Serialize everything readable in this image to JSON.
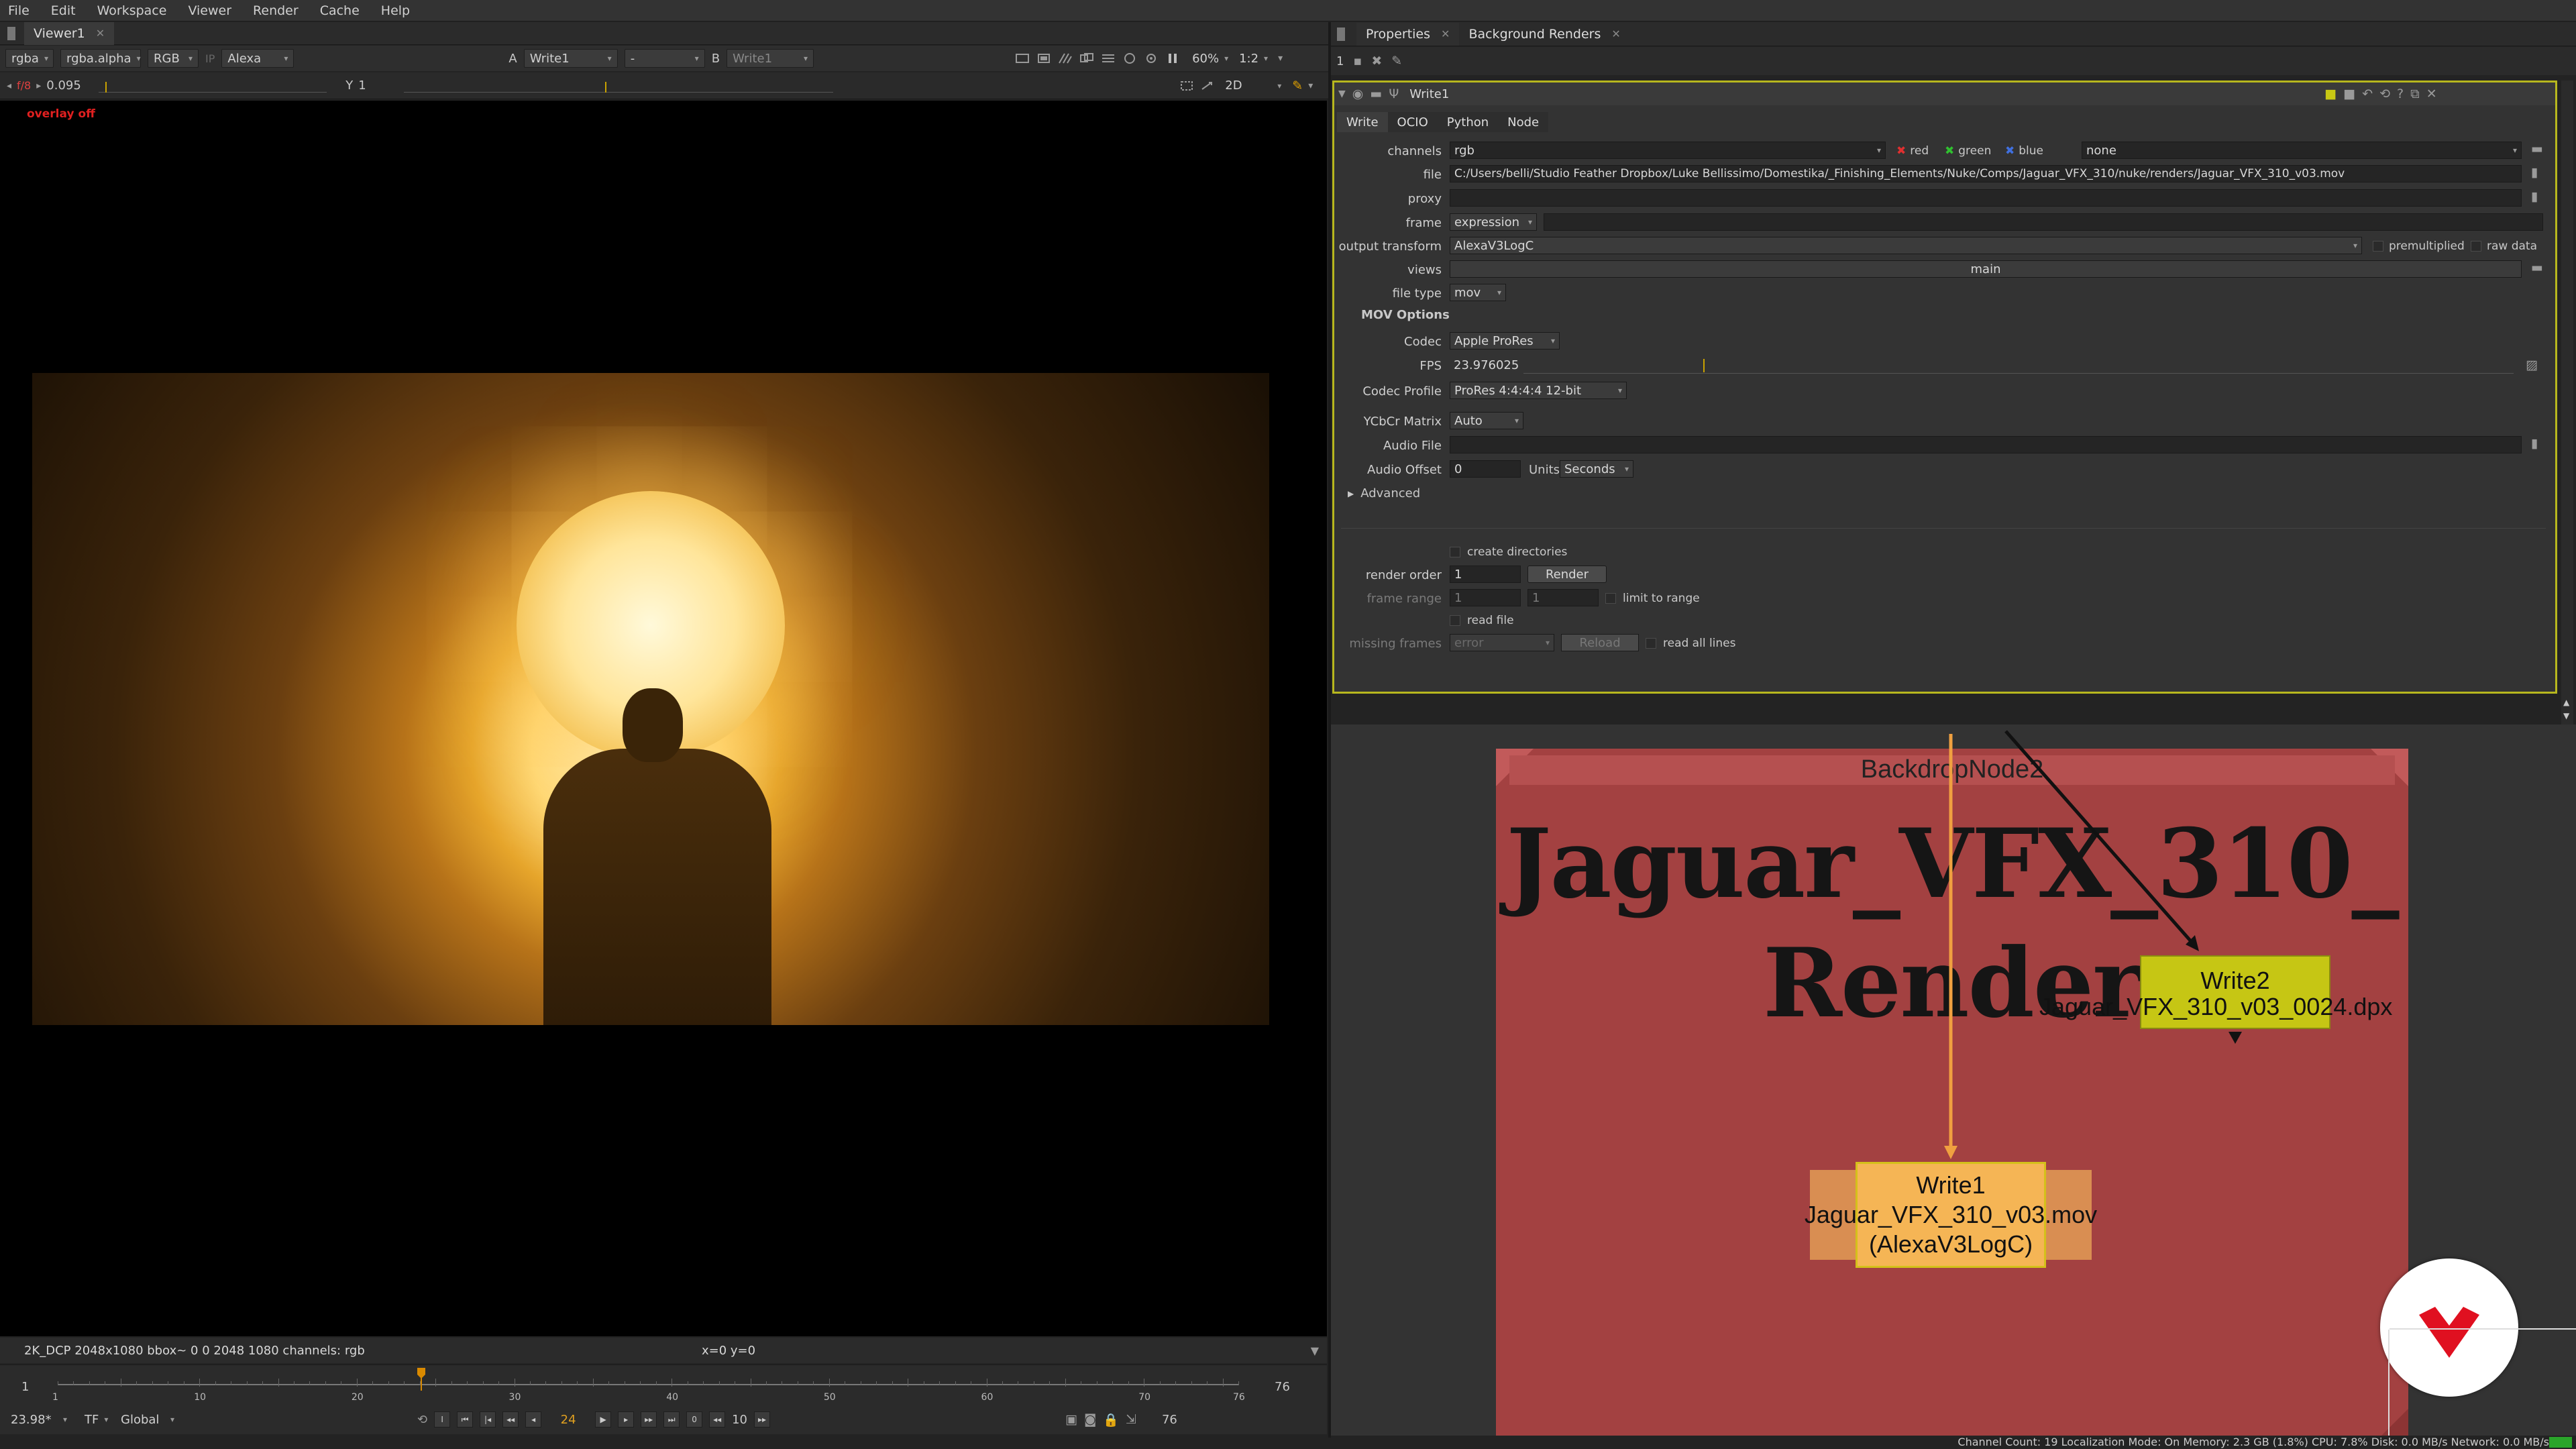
{
  "menu": [
    "File",
    "Edit",
    "Workspace",
    "Viewer",
    "Render",
    "Cache",
    "Help"
  ],
  "viewer": {
    "tab": "Viewer1",
    "channels": "rgba",
    "alpha": "rgba.alpha",
    "display": "RGB",
    "ip": "IP",
    "view_transform": "Alexa",
    "a_label": "A",
    "a_input": "Write1",
    "wipe": "-",
    "b_label": "B",
    "b_input": "Write1",
    "zoom": "60%",
    "proxy_ratio": "1:2",
    "gain_label": "f/8",
    "gain": "0.095",
    "gamma_label": "Y",
    "gamma": "1",
    "mode_2d": "2D",
    "overlay": "overlay off",
    "format": "2K_DCP 2048x1080  bbox~ 0 0 2048 1080 channels: rgb",
    "coords": "x=0 y=0"
  },
  "timeline": {
    "start": "1",
    "end": "76",
    "ticks": [
      "1",
      "10",
      "20",
      "30",
      "40",
      "50",
      "60",
      "70",
      "76"
    ],
    "fps": "23.98*",
    "tf": "TF",
    "range_mode": "Global",
    "current_frame": "24",
    "step": "10",
    "out_frame": "76",
    "zero": "0"
  },
  "props": {
    "tabs": [
      "Properties",
      "Background Renders"
    ],
    "count": "1",
    "node_name": "Write1",
    "node_tabs": [
      "Write",
      "OCIO",
      "Python",
      "Node"
    ],
    "channels_label": "channels",
    "channels_value": "rgb",
    "ch_red": "red",
    "ch_green": "green",
    "ch_blue": "blue",
    "ch_extra": "none",
    "file_label": "file",
    "file_value": "C:/Users/belli/Studio Feather Dropbox/Luke Bellissimo/Domestika/_Finishing_Elements/Nuke/Comps/Jaguar_VFX_310/nuke/renders/Jaguar_VFX_310_v03.mov",
    "proxy_label": "proxy",
    "frame_label": "frame",
    "frame_value": "expression",
    "ot_label": "output transform",
    "ot_value": "AlexaV3LogC",
    "premult": "premultiplied",
    "raw": "raw data",
    "views_label": "views",
    "views_value": "main",
    "filetype_label": "file type",
    "filetype_value": "mov",
    "mov_header": "MOV Options",
    "codec_label": "Codec",
    "codec_value": "Apple ProRes",
    "fps_label": "FPS",
    "fps_value": "23.976025",
    "profile_label": "Codec Profile",
    "profile_value": "ProRes 4:4:4:4 12-bit",
    "ycbcr_label": "YCbCr Matrix",
    "ycbcr_value": "Auto",
    "audio_label": "Audio File",
    "offset_label": "Audio Offset",
    "offset_value": "0",
    "units_label": "Units",
    "units_value": "Seconds",
    "advanced": "Advanced",
    "create_dirs": "create directories",
    "order_label": "render order",
    "order_value": "1",
    "render_btn": "Render",
    "range_label": "frame range",
    "range_a": "1",
    "range_b": "1",
    "limit": "limit to range",
    "read_file": "read file",
    "missing_label": "missing frames",
    "missing_value": "error",
    "reload": "Reload",
    "read_lines": "read all lines"
  },
  "nodegraph": {
    "backdrop_name": "BackdropNode2",
    "backdrop_label": "Jaguar_VFX_310_Render",
    "write2": {
      "name": "Write2",
      "file": "Jaguar_VFX_310_v03_0024.dpx"
    },
    "write1": {
      "name": "Write1",
      "file": "Jaguar_VFX_310_v03.mov",
      "transform": "(AlexaV3LogC)"
    }
  },
  "status": "Channel Count: 19  Localization Mode: On  Memory: 2.3 GB (1.8%)  CPU: 7.8%  Disk: 0.0 MB/s  Network: 0.0 MB/s",
  "colors": {
    "accent": "#b7b71e",
    "backdrop": "#a34141",
    "write1": "#f5b555",
    "write2": "#c6c614"
  }
}
